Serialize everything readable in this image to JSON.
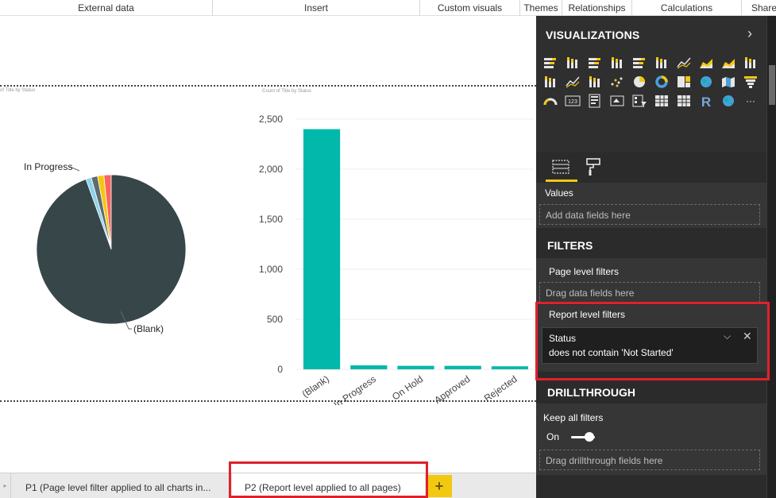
{
  "ribbon": {
    "groups": [
      "External data",
      "Insert",
      "Custom visuals",
      "Themes",
      "Relationships",
      "Calculations",
      "Share"
    ]
  },
  "canvas": {
    "pie_visual_title": "of Title by Status",
    "bar_visual_title": "Count of Title by Status",
    "pie_label_in_progress": "In Progress",
    "pie_label_blank": "(Blank)"
  },
  "chart_data": [
    {
      "type": "pie",
      "title": "Count of Title by Status",
      "slices": [
        {
          "label": "(Blank)",
          "value": 2400,
          "color": "#374649"
        },
        {
          "label": "In Progress",
          "value": 40,
          "color": "#fd625e"
        },
        {
          "label": "On Hold",
          "value": 35,
          "color": "#f2c80f"
        },
        {
          "label": "Approved",
          "value": 35,
          "color": "#5f6b6d"
        },
        {
          "label": "Rejected",
          "value": 30,
          "color": "#8ad4eb"
        }
      ],
      "visible_labels": [
        "In Progress",
        "(Blank)"
      ]
    },
    {
      "type": "bar",
      "title": "Count of Title by Status",
      "categories": [
        "(Blank)",
        "In Progress",
        "On Hold",
        "Approved",
        "Rejected"
      ],
      "values": [
        2400,
        40,
        35,
        35,
        30
      ],
      "ylim": [
        0,
        2500
      ],
      "yticks": [
        "0",
        "500",
        "1,000",
        "1,500",
        "2,000",
        "2,500"
      ],
      "ytick_values": [
        0,
        500,
        1000,
        1500,
        2000,
        2500
      ],
      "color": "#01b8aa",
      "grid": true
    }
  ],
  "pages": {
    "tabs": [
      {
        "label": "P1 (Page level filter applied to all charts in...",
        "active": false
      },
      {
        "label": "P2 (Report level applied to all pages)",
        "active": true
      }
    ],
    "add_label": "+"
  },
  "visualizations": {
    "title": "VISUALIZATIONS",
    "collapse_icon": "chevron-right-icon",
    "icons": [
      "stacked-bar-icon",
      "stacked-column-icon",
      "clustered-bar-icon",
      "clustered-column-icon",
      "100-stacked-bar-icon",
      "100-stacked-column-icon",
      "line-chart-icon",
      "area-chart-icon",
      "stacked-area-icon",
      "line-clustered-column-icon",
      "line-stacked-column-icon",
      "ribbon-chart-icon",
      "waterfall-chart-icon",
      "scatter-chart-icon",
      "pie-chart-icon",
      "donut-chart-icon",
      "treemap-icon",
      "map-icon",
      "filled-map-icon",
      "funnel-icon",
      "gauge-icon",
      "card-icon",
      "multi-row-card-icon",
      "kpi-icon",
      "slicer-icon",
      "table-icon",
      "matrix-icon",
      "r-script-icon",
      "globe-icon",
      "more-icon"
    ],
    "r_glyph": "R",
    "card_glyph": "123",
    "more_glyph": "···"
  },
  "wells": {
    "values_label": "Values",
    "values_placeholder": "Add data fields here"
  },
  "filters": {
    "heading": "FILTERS",
    "page_level_label": "Page level filters",
    "page_level_placeholder": "Drag data fields here",
    "report_level_label": "Report level filters",
    "filter_card": {
      "field": "Status",
      "description": "does not contain 'Not Started'"
    }
  },
  "drillthrough": {
    "heading": "DRILLTHROUGH",
    "keep_all_label": "Keep all filters",
    "toggle_state": "On",
    "placeholder": "Drag drillthrough fields here"
  },
  "colors": {
    "highlight_red": "#e0212b",
    "accent_yellow": "#f2c811",
    "panel_dark": "#2b2b2b"
  }
}
